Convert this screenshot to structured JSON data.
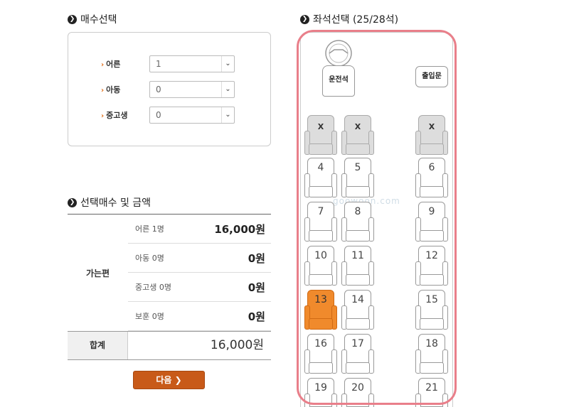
{
  "qty_section": {
    "title": "매수선택",
    "rows": [
      {
        "label": "어른",
        "value": "1"
      },
      {
        "label": "아동",
        "value": "0"
      },
      {
        "label": "중고생",
        "value": "0"
      }
    ]
  },
  "price_section": {
    "title": "선택매수 및 금액",
    "direction": "가는편",
    "rows": [
      {
        "label": "어른 1명",
        "amount": "16,000원"
      },
      {
        "label": "아동 0명",
        "amount": "0원"
      },
      {
        "label": "중고생 0명",
        "amount": "0원"
      },
      {
        "label": "보훈 0명",
        "amount": "0원"
      }
    ],
    "total_label": "합계",
    "total_amount": "16,000원"
  },
  "next_button": {
    "label": "다음 ❯"
  },
  "seat_section": {
    "title": "좌석선택 (25/28석)",
    "driver_label": "운전석",
    "entrance_label": "출입문",
    "watermark": "goowoon.com",
    "seats": [
      {
        "label": "X",
        "state": "taken"
      },
      {
        "label": "X",
        "state": "taken"
      },
      {
        "label": "X",
        "state": "taken"
      },
      {
        "label": "4",
        "state": "available"
      },
      {
        "label": "5",
        "state": "available"
      },
      {
        "label": "6",
        "state": "available"
      },
      {
        "label": "7",
        "state": "available"
      },
      {
        "label": "8",
        "state": "available"
      },
      {
        "label": "9",
        "state": "available"
      },
      {
        "label": "10",
        "state": "available"
      },
      {
        "label": "11",
        "state": "available"
      },
      {
        "label": "12",
        "state": "available"
      },
      {
        "label": "13",
        "state": "selected"
      },
      {
        "label": "14",
        "state": "available"
      },
      {
        "label": "15",
        "state": "available"
      },
      {
        "label": "16",
        "state": "available"
      },
      {
        "label": "17",
        "state": "available"
      },
      {
        "label": "18",
        "state": "available"
      },
      {
        "label": "19",
        "state": "available"
      },
      {
        "label": "20",
        "state": "available"
      },
      {
        "label": "21",
        "state": "available"
      }
    ]
  },
  "colors": {
    "accent": "#c85a19",
    "selected_seat": "#f08a2c",
    "highlight_border": "#e97f8a",
    "taken_seat": "#dddddd"
  }
}
